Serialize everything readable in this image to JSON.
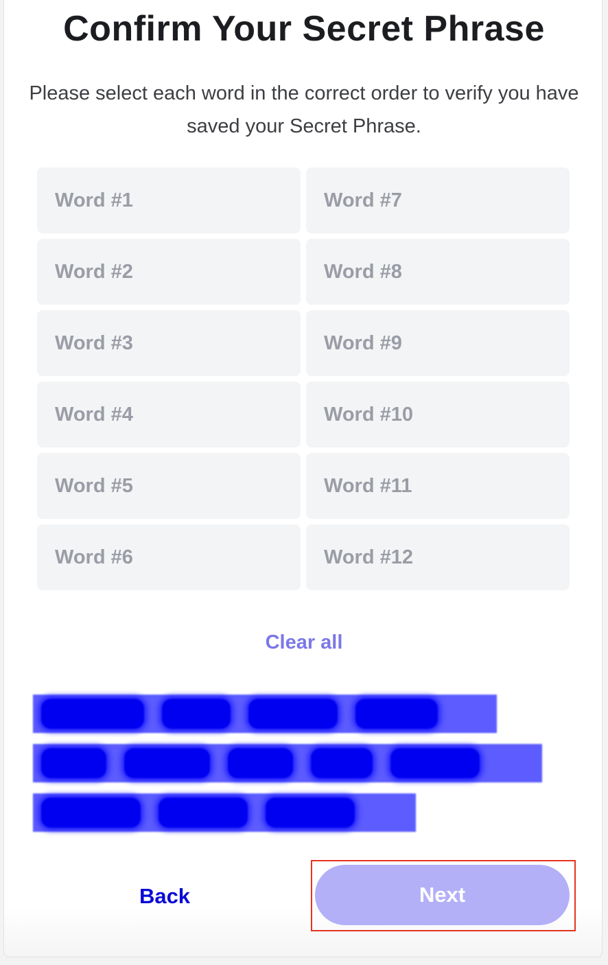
{
  "header": {
    "title": "Confirm Your Secret Phrase",
    "subtitle": "Please select each word in the correct order to verify you have saved your Secret Phrase."
  },
  "slots": {
    "left": [
      "Word #1",
      "Word #2",
      "Word #3",
      "Word #4",
      "Word #5",
      "Word #6"
    ],
    "right": [
      "Word #7",
      "Word #8",
      "Word #9",
      "Word #10",
      "Word #11",
      "Word #12"
    ]
  },
  "clear_all_label": "Clear all",
  "word_bank": {
    "note": "words are redacted/blurred in the screenshot",
    "rows": [
      4,
      5,
      3
    ]
  },
  "footer": {
    "back_label": "Back",
    "next_label": "Next"
  },
  "colors": {
    "accent": "#7b78e8",
    "next_disabled": "#b3b0f8",
    "back_link": "#0a0ad6",
    "highlight_border": "#e5331f",
    "redaction": "#0000f0"
  }
}
